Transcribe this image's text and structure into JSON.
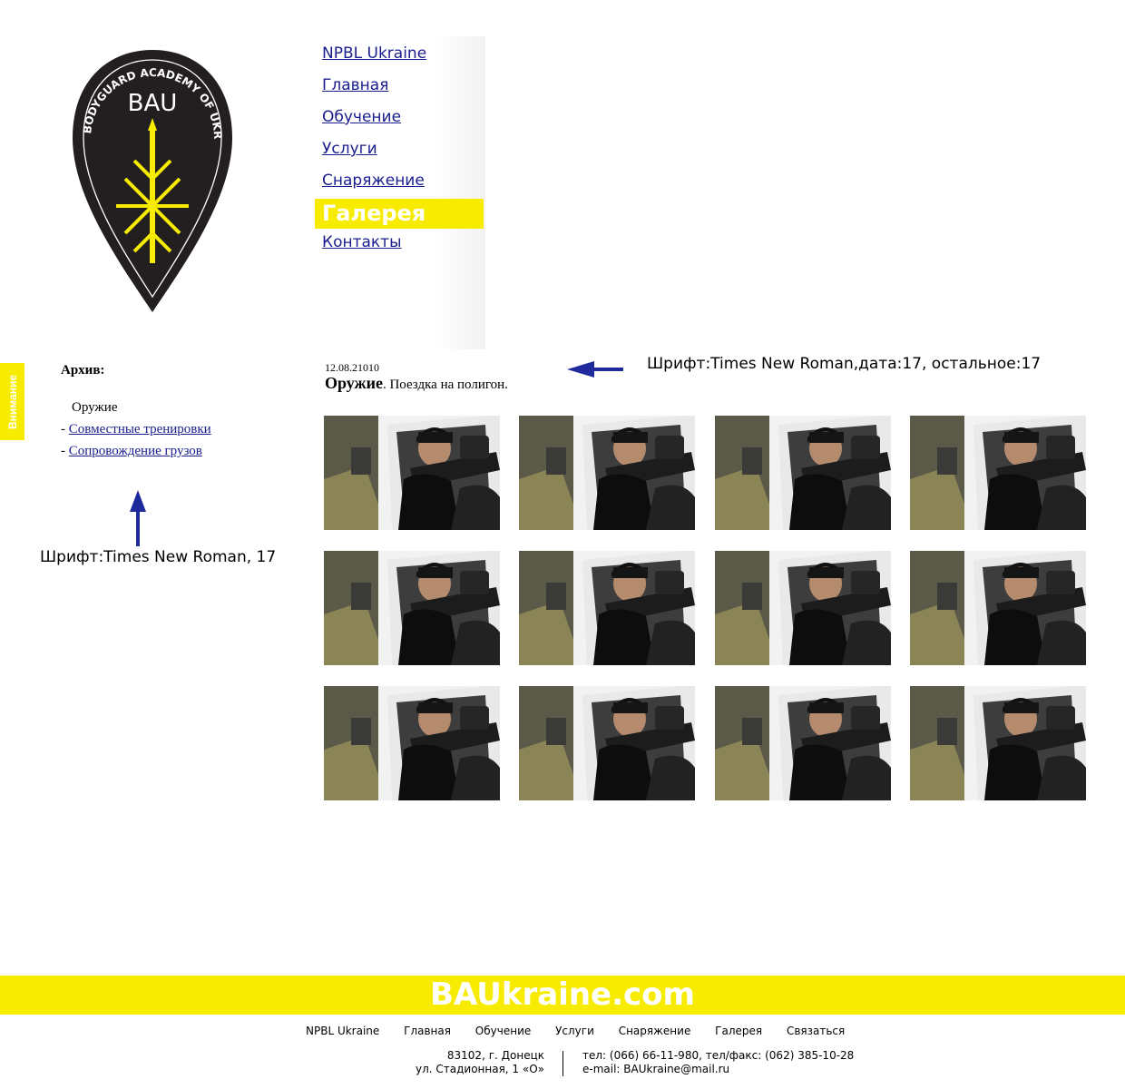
{
  "logo": {
    "abbr": "BAU",
    "ring_text": "BODYGUARD ACADEMY OF UKRAINE",
    "colors": {
      "shield": "#231f20",
      "accent": "#f7ec00"
    }
  },
  "nav": {
    "items": [
      {
        "label": "NPBL Ukraine"
      },
      {
        "label": "Главная"
      },
      {
        "label": "Обучение"
      },
      {
        "label": "Услуги"
      },
      {
        "label": "Снаряжение"
      },
      {
        "label": "Галерея",
        "active": true
      },
      {
        "label": "Контакты"
      }
    ]
  },
  "side_tab": {
    "label": "Внимание"
  },
  "archive": {
    "title": "Архив:",
    "items": [
      {
        "label": "Оружие",
        "link": false
      },
      {
        "label": "Совместные тренировки",
        "link": true
      },
      {
        "label": "Сопровождение грузов",
        "link": true
      }
    ],
    "item_prefix": "- "
  },
  "notes": {
    "left": "Шрифт:Times New Roman, 17",
    "right": "Шрифт:Times New Roman,дата:17, остальное:17"
  },
  "post": {
    "date": "12.08.21010",
    "title_bold": "Оружие",
    "title_rest": ". Поездка на полигон."
  },
  "gallery": {
    "count": 12,
    "columns": 4
  },
  "footer": {
    "brand": "BAUkraine.com",
    "nav": [
      "NPBL Ukraine",
      "Главная",
      "Обучение",
      "Услуги",
      "Снаряжение",
      "Галерея",
      "Связаться"
    ],
    "address_line1": "83102, г. Донецк",
    "address_line2": "ул. Стадионная, 1 «О»",
    "phone_line": "тел: (066) 66-11-980, тел/факс: (062) 385-10-28",
    "email_line": "e-mail: BAUkraine@mail.ru"
  },
  "colors": {
    "brand_yellow": "#f7ec00",
    "link_blue": "#1a1d8e",
    "arrow_blue": "#1f2a9c"
  }
}
